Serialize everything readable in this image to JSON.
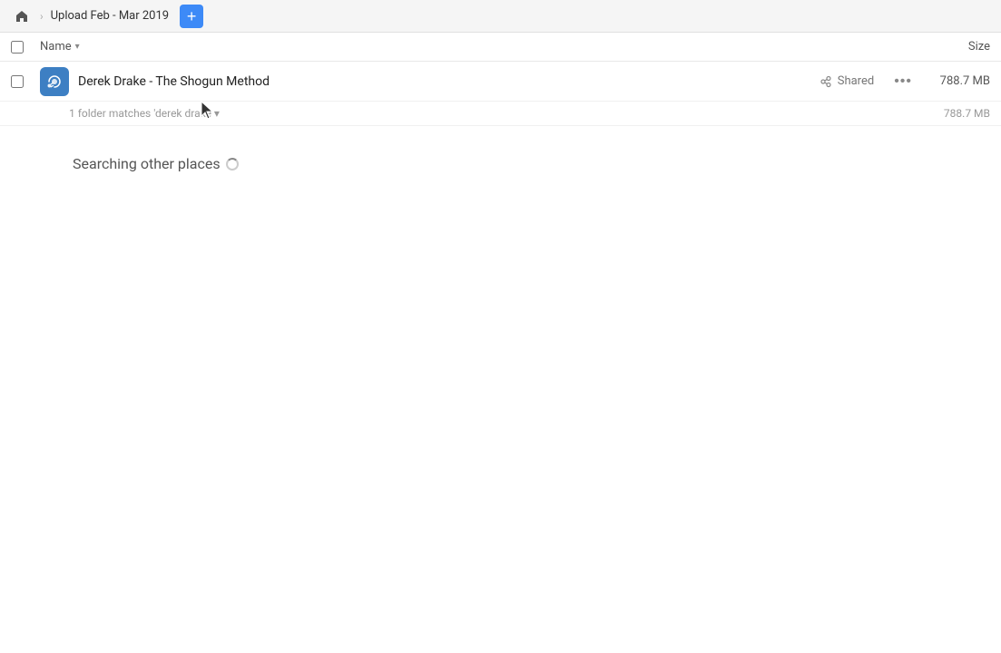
{
  "header": {
    "home_icon": "🏠",
    "breadcrumb_label": "Upload Feb - Mar 2019",
    "add_btn_label": "+"
  },
  "columns": {
    "name_label": "Name",
    "name_sort_arrow": "▾",
    "size_label": "Size"
  },
  "file_row": {
    "icon_symbol": "🔗",
    "name": "Derek Drake - The Shogun Method",
    "shared_label": "Shared",
    "more_label": "•••",
    "size": "788.7 MB"
  },
  "summary_row": {
    "text": "1 folder matches 'derek drake ▾",
    "size": "788.7 MB"
  },
  "searching_section": {
    "label": "Searching other places"
  }
}
